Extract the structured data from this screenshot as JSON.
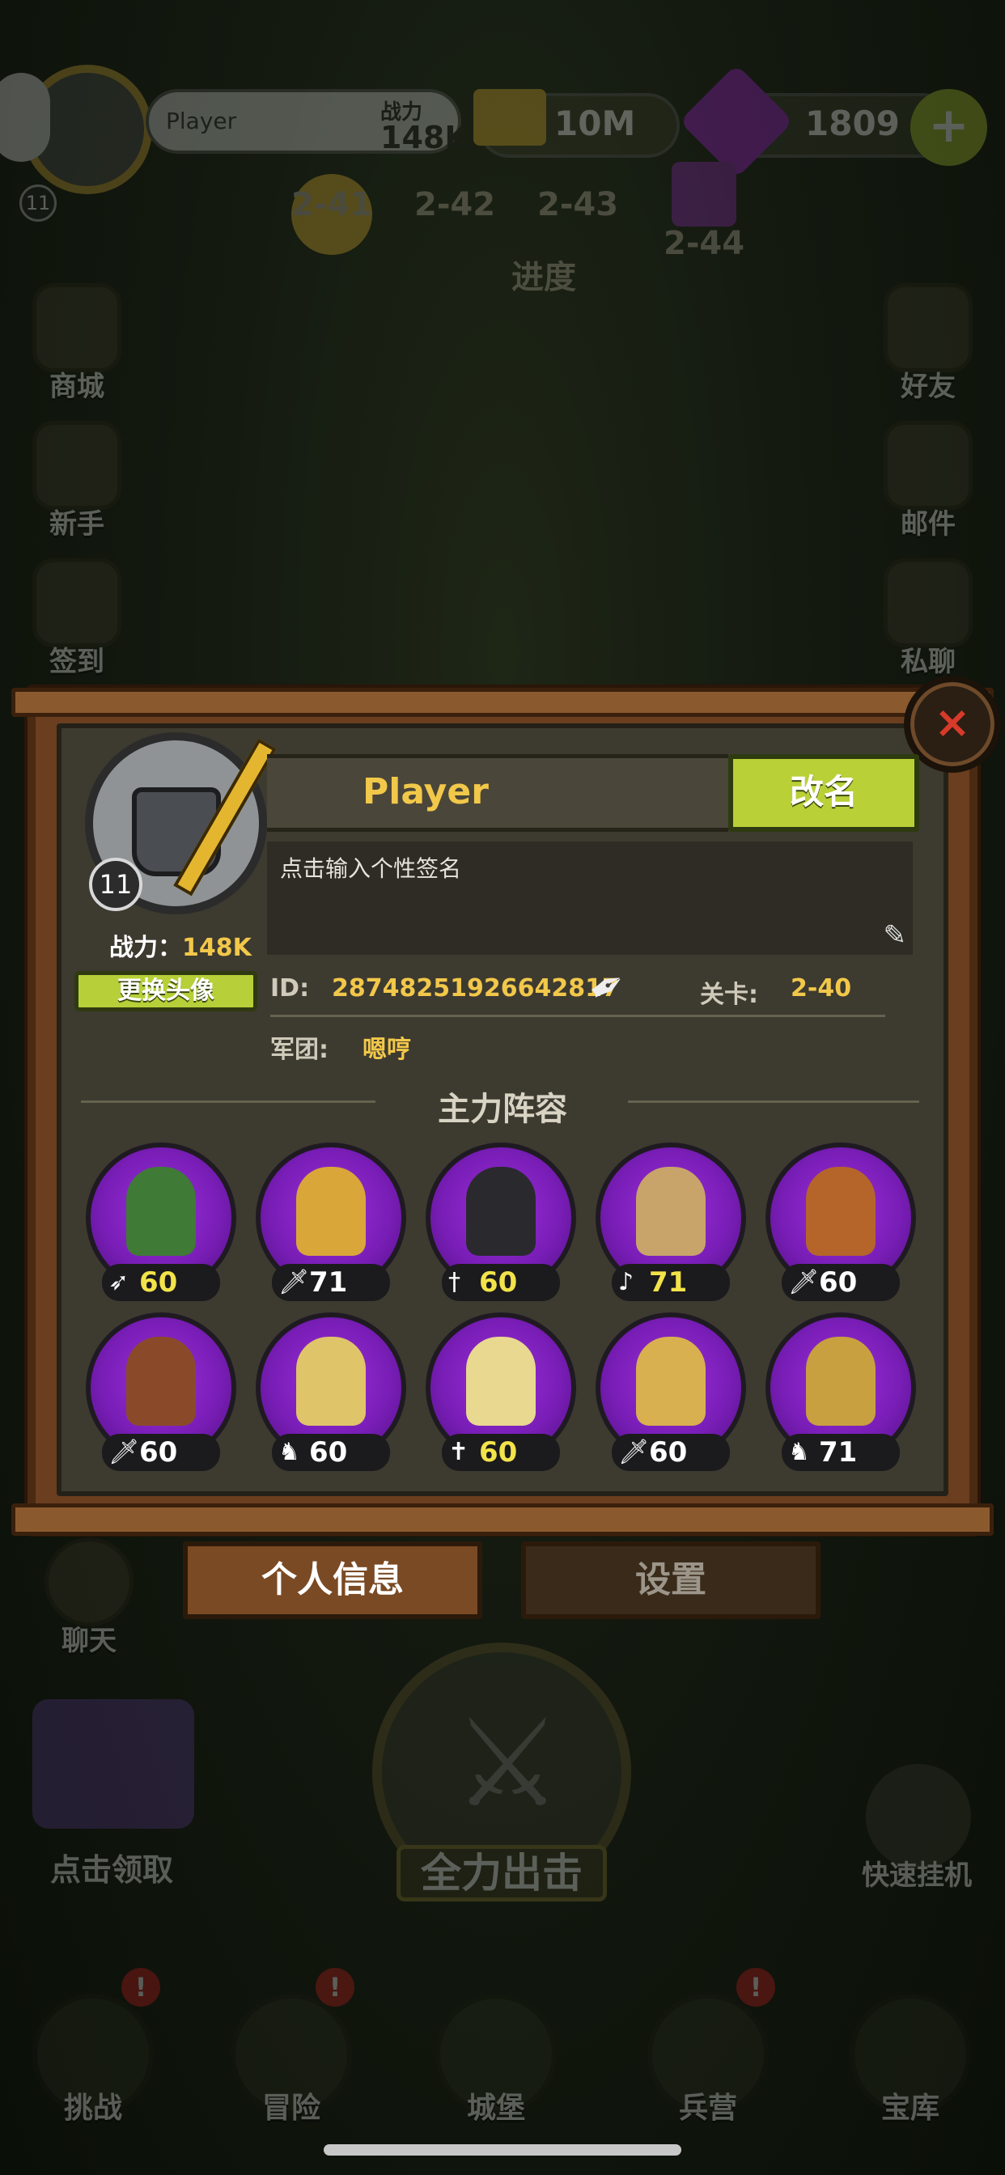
{
  "top_bar": {
    "level": "11",
    "player_name": "Player",
    "power_label": "战力",
    "power_value": "148K",
    "gold": "10M",
    "gems": "1809",
    "add_symbol": "+"
  },
  "progress": {
    "stages": [
      "2-41",
      "2-42",
      "2-43",
      "2-44"
    ],
    "label": "进度"
  },
  "left_menu": [
    "商城",
    "新手",
    "签到",
    "聊天"
  ],
  "right_menu": [
    "好友",
    "邮件",
    "私聊"
  ],
  "bottom": {
    "claim_label": "点击领取",
    "attack_label": "全力出击",
    "afk_label": "快速挂机",
    "nav": [
      "挑战",
      "冒险",
      "城堡",
      "兵营",
      "宝库"
    ],
    "badge": "!"
  },
  "profile": {
    "close_symbol": "×",
    "level": "11",
    "power_label": "战力：",
    "power_value": "148K",
    "change_avatar_label": "更换头像",
    "name": "Player",
    "rename_label": "改名",
    "signature_placeholder": "点击输入个性签名",
    "id_label": "ID:",
    "id_value": "28748251926642817",
    "stage_label": "关卡:",
    "stage_value": "2-40",
    "legion_label": "军团:",
    "legion_value": "嗯哼",
    "lineup_title": "主力阵容",
    "heroes": [
      {
        "class_icon": "bow-class-icon",
        "level": "60",
        "level_color": "#f2e34a",
        "figure_color": "#3f7a36"
      },
      {
        "class_icon": "sword-class-icon",
        "level": "71",
        "level_color": "#ffffff",
        "figure_color": "#d9a63a"
      },
      {
        "class_icon": "dagger-class-icon",
        "level": "60",
        "level_color": "#f2e34a",
        "figure_color": "#2a2a2e"
      },
      {
        "class_icon": "staff-class-icon",
        "level": "71",
        "level_color": "#f2e34a",
        "figure_color": "#c8a46a"
      },
      {
        "class_icon": "sword-class-icon",
        "level": "60",
        "level_color": "#ffffff",
        "figure_color": "#b5652a"
      },
      {
        "class_icon": "sword-class-icon",
        "level": "60",
        "level_color": "#ffffff",
        "figure_color": "#8a4a2a"
      },
      {
        "class_icon": "cavalry-class-icon",
        "level": "60",
        "level_color": "#ffffff",
        "figure_color": "#e0c46a"
      },
      {
        "class_icon": "cross-class-icon",
        "level": "60",
        "level_color": "#f2e34a",
        "figure_color": "#e8d890"
      },
      {
        "class_icon": "sword-class-icon",
        "level": "60",
        "level_color": "#ffffff",
        "figure_color": "#d8b050"
      },
      {
        "class_icon": "cavalry-class-icon",
        "level": "71",
        "level_color": "#ffffff",
        "figure_color": "#c8a040"
      }
    ],
    "tabs": [
      "个人信息",
      "设置"
    ]
  }
}
